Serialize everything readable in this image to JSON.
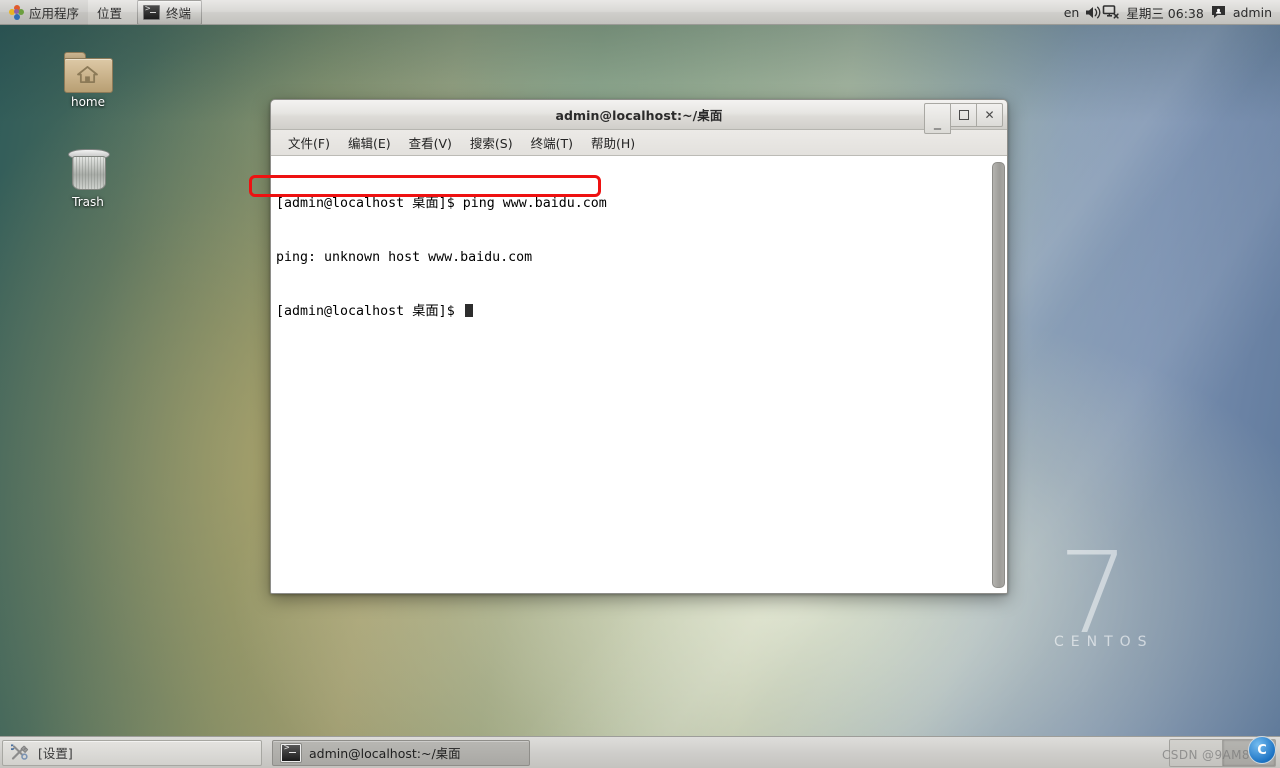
{
  "top_panel": {
    "applications_label": "应用程序",
    "places_label": "位置",
    "active_window_label": "终端",
    "apps_icon": "applications-grid-icon",
    "language_indicator": "en",
    "volume_icon": "speaker-icon",
    "network_icon": "network-disconnected-icon",
    "datetime": "星期三 06:38",
    "user_icon": "user-chat-icon",
    "user_name": "admin"
  },
  "desktop": {
    "icons": [
      {
        "name": "home",
        "label": "home",
        "glyph": "folder-home-icon"
      },
      {
        "name": "trash",
        "label": "Trash",
        "glyph": "trash-can-icon"
      }
    ],
    "branding": {
      "version": "7",
      "distro": "CENTOS"
    }
  },
  "terminal": {
    "title": "admin@localhost:~/桌面",
    "window_controls": {
      "minimize_label": "_",
      "maximize_label": "□",
      "close_label": "✕"
    },
    "menu": [
      {
        "name": "file",
        "label": "文件(F)"
      },
      {
        "name": "edit",
        "label": "编辑(E)"
      },
      {
        "name": "view",
        "label": "查看(V)"
      },
      {
        "name": "search",
        "label": "搜索(S)"
      },
      {
        "name": "terminal",
        "label": "终端(T)"
      },
      {
        "name": "help",
        "label": "帮助(H)"
      }
    ],
    "lines": [
      "[admin@localhost 桌面]$ ping www.baidu.com",
      "ping: unknown host www.baidu.com",
      "[admin@localhost 桌面]$ "
    ],
    "annotation": {
      "target_line": "ping: unknown host www.baidu.com",
      "color": "#ee1111"
    }
  },
  "taskbar": {
    "settings_label": "[设置]",
    "settings_icon": "tools-icon",
    "task_button_label": "admin@localhost:~/桌面",
    "task_button_icon": "terminal-icon",
    "workspaces": [
      {
        "name": "workspace-1",
        "active": false
      },
      {
        "name": "workspace-2",
        "active": true
      }
    ]
  },
  "watermark": {
    "text": "CSDN @9AM8323"
  }
}
